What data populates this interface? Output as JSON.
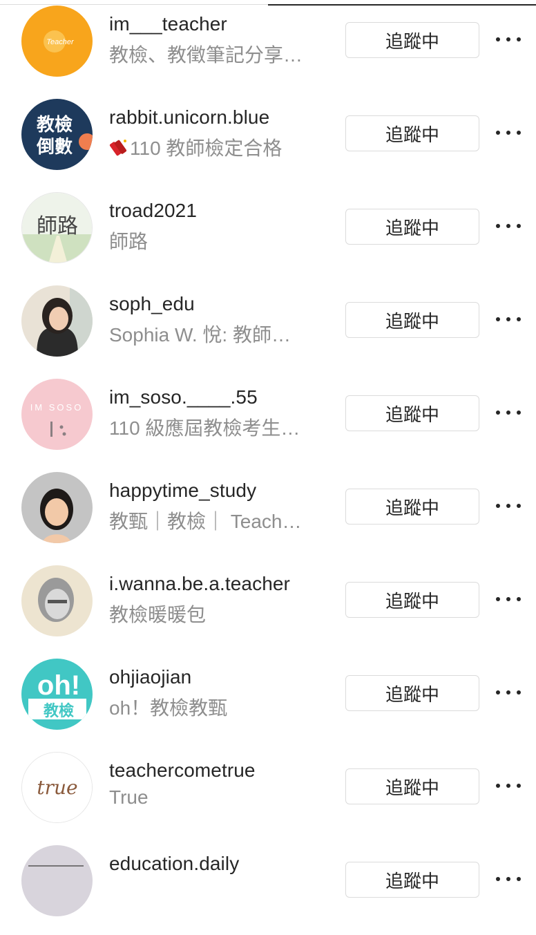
{
  "following_list": [
    {
      "username": "im___teacher",
      "bio": "教檢、教徵筆記分享…",
      "button": "追蹤中",
      "avatar_text": "Teacher"
    },
    {
      "username": "rabbit.unicorn.blue",
      "bio": "110 教師檢定合格",
      "bio_emoji": "firecracker-icon",
      "button": "追蹤中",
      "avatar_text": "教檢倒數"
    },
    {
      "username": "troad2021",
      "bio": "師路",
      "button": "追蹤中",
      "avatar_text": "師路"
    },
    {
      "username": "soph_edu",
      "bio": "Sophia W. 悅: 教師…",
      "button": "追蹤中"
    },
    {
      "username": "im_soso.____.55",
      "bio": "110 級應屆教檢考生…",
      "button": "追蹤中",
      "avatar_text": "IM SOSO"
    },
    {
      "username": "happytime_study",
      "bio": "教甄｜教檢｜ Teach…",
      "button": "追蹤中"
    },
    {
      "username": "i.wanna.be.a.teacher",
      "bio": "教檢暖暖包",
      "button": "追蹤中"
    },
    {
      "username": "ohjiaojian",
      "bio": "oh！教檢教甄",
      "button": "追蹤中",
      "avatar_text": "oh!教檢"
    },
    {
      "username": "teachercometrue",
      "bio": "True",
      "button": "追蹤中",
      "avatar_text": "true"
    },
    {
      "username": "education.daily",
      "bio": "",
      "button": "追蹤中"
    }
  ],
  "colors": {
    "text": "#262626",
    "secondary": "#8e8e8e",
    "border": "#dbdbdb"
  }
}
